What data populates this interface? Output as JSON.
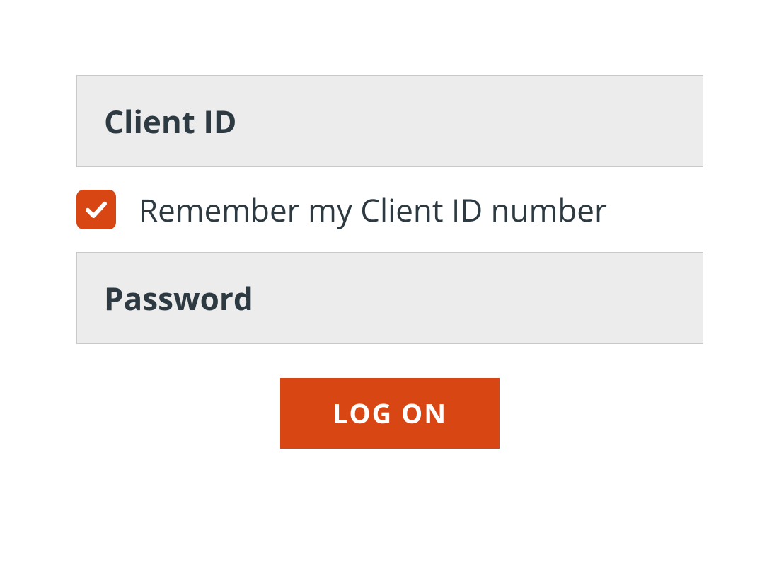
{
  "form": {
    "client_id_placeholder": "Client ID",
    "client_id_value": "",
    "remember_checked": true,
    "remember_label": "Remember my Client ID number",
    "password_placeholder": "Password",
    "password_value": "",
    "logon_label": "LOG ON"
  },
  "colors": {
    "accent": "#d84613",
    "input_bg": "#ececec",
    "input_border": "#c9c9c9",
    "text": "#2d3a42"
  }
}
